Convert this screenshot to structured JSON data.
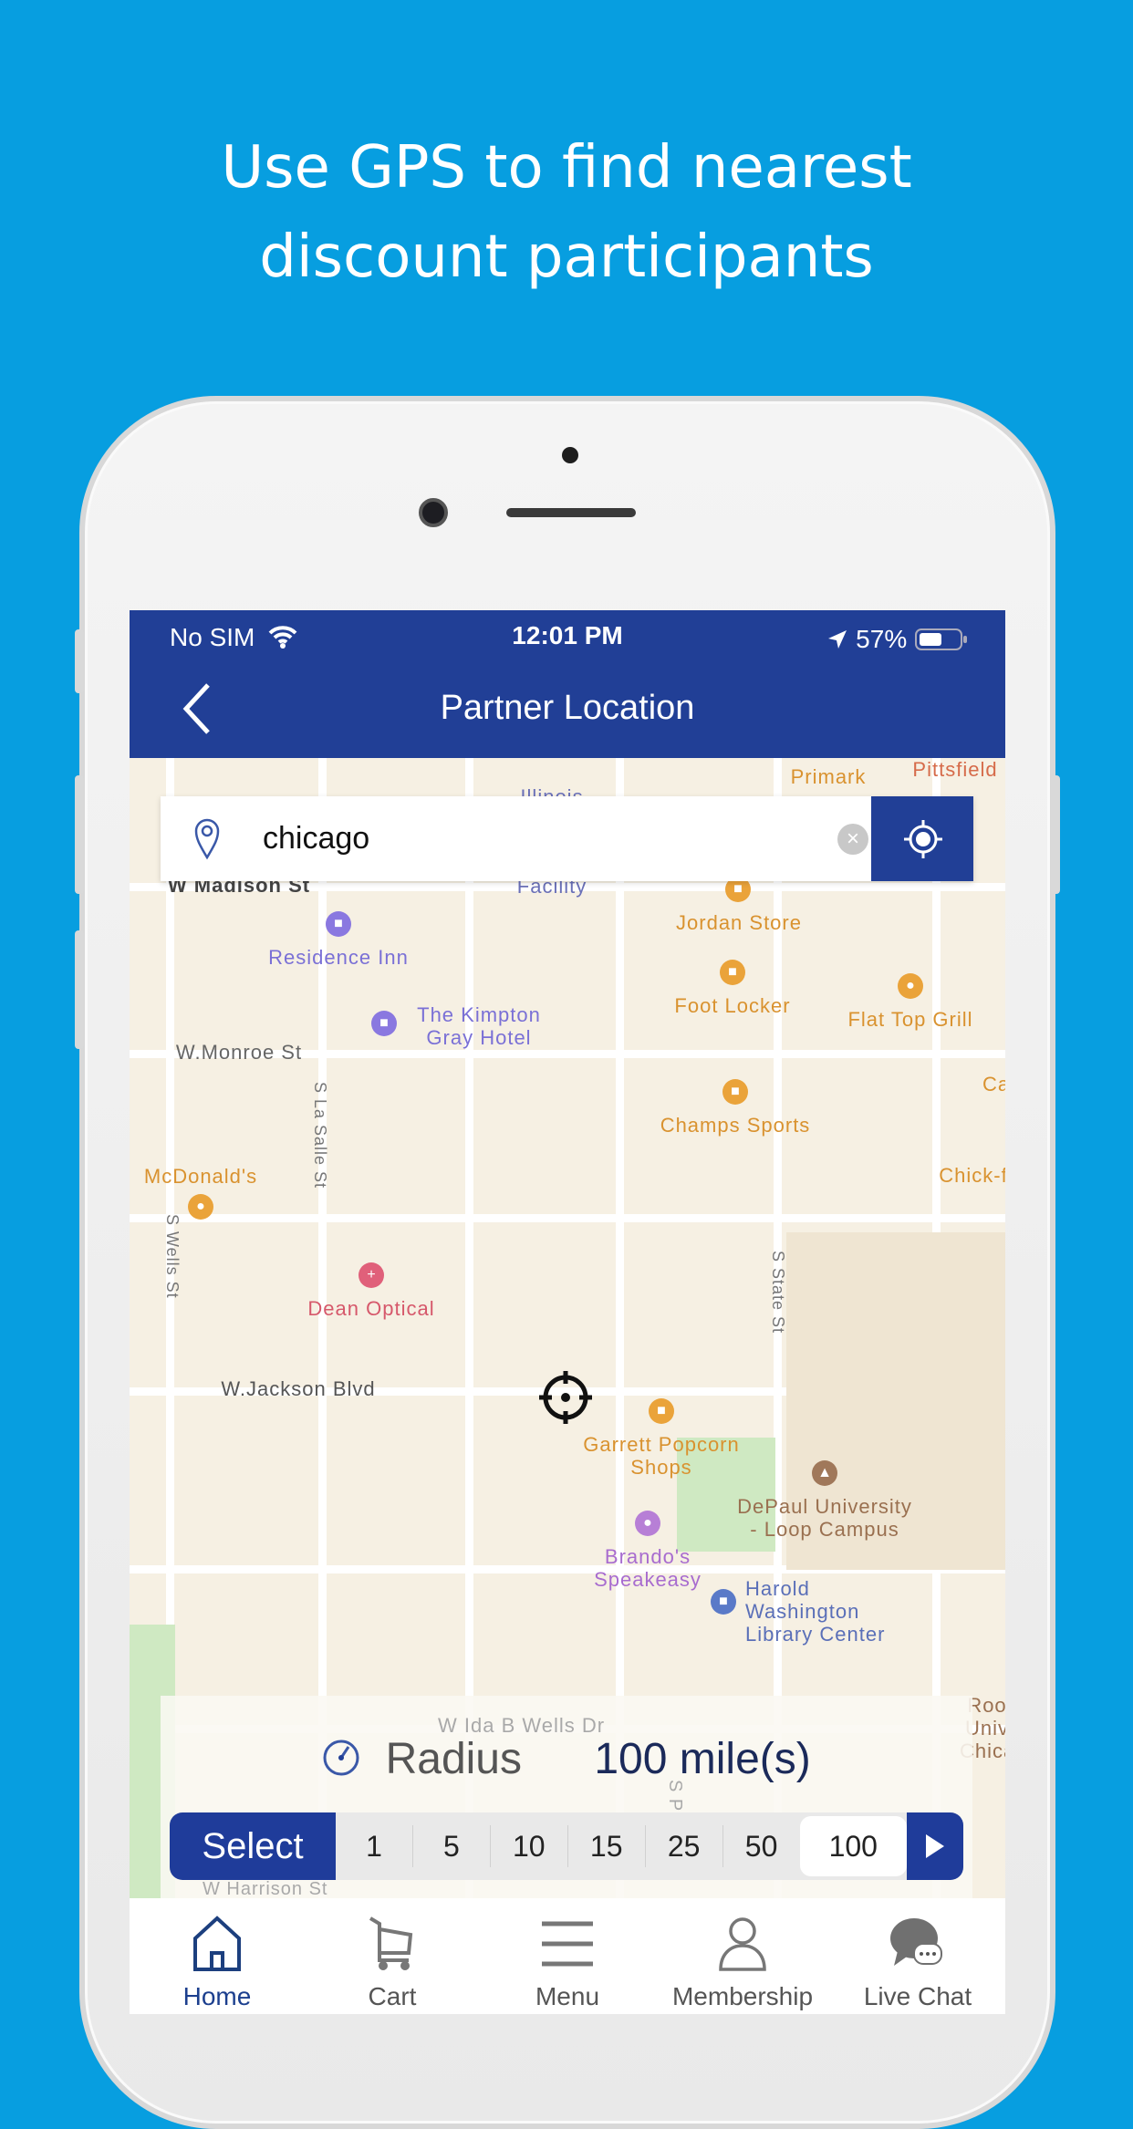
{
  "headline": [
    "Use GPS to find nearest",
    "discount participants"
  ],
  "status_bar": {
    "carrier": "No SIM",
    "time": "12:01 PM",
    "battery": "57%"
  },
  "nav": {
    "title": "Partner Location"
  },
  "search": {
    "value": "chicago"
  },
  "map": {
    "streets": [
      "W Madison St",
      "W.Monroe St",
      "W.Jackson Blvd",
      "S La Salle St",
      "S Wells St",
      "S State St",
      "W Ida B Wells Dr",
      "W Harrison St",
      "S Plym"
    ],
    "places": [
      {
        "name": "Illinois",
        "type": "transit"
      },
      {
        "name": "Facility",
        "type": "other"
      },
      {
        "name": "Primark",
        "type": "shop"
      },
      {
        "name": "Pittsfield",
        "type": "other"
      },
      {
        "name": "Jordan Store",
        "type": "shop"
      },
      {
        "name": "Residence Inn",
        "type": "hotel"
      },
      {
        "name": "The Kimpton Gray Hotel",
        "type": "hotel"
      },
      {
        "name": "Foot Locker",
        "type": "shop"
      },
      {
        "name": "Flat Top Grill",
        "type": "restaurant"
      },
      {
        "name": "Champs Sports",
        "type": "shop"
      },
      {
        "name": "McDonald's",
        "type": "restaurant"
      },
      {
        "name": "Ca",
        "type": "restaurant"
      },
      {
        "name": "Chick-f",
        "type": "restaurant"
      },
      {
        "name": "Dean Optical",
        "type": "health"
      },
      {
        "name": "Garrett Popcorn Shops",
        "type": "shop"
      },
      {
        "name": "DePaul University - Loop Campus",
        "type": "school"
      },
      {
        "name": "Brando's Speakeasy",
        "type": "bar"
      },
      {
        "name": "Harold Washington Library Center",
        "type": "library"
      },
      {
        "name": "Roo Univ Chicag",
        "type": "school"
      }
    ]
  },
  "radius": {
    "label": "Radius",
    "value": "100 mile(s)"
  },
  "selector": {
    "label": "Select",
    "options": [
      "1",
      "5",
      "10",
      "15",
      "25",
      "50",
      "100"
    ],
    "selected": "100"
  },
  "tabs": [
    {
      "label": "Home",
      "icon": "home-icon",
      "active": true
    },
    {
      "label": "Cart",
      "icon": "cart-icon"
    },
    {
      "label": "Menu",
      "icon": "menu-icon"
    },
    {
      "label": "Membership",
      "icon": "user-icon"
    },
    {
      "label": "Live Chat",
      "icon": "chat-icon"
    }
  ],
  "colors": {
    "background": "#079ee0",
    "primary": "#213f96",
    "map": "#f6f0e3",
    "shop": "#e5972c",
    "hotel": "#8a78e0"
  }
}
